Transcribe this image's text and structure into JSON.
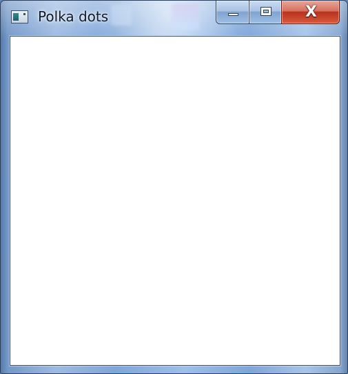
{
  "window": {
    "title": "Polka dots",
    "icon": "application-window-icon"
  },
  "caption_buttons": {
    "minimize": "minimize-icon",
    "maximize": "maximize-icon",
    "close": "close-icon",
    "close_glyph": "X",
    "close_color": "#c8402a"
  },
  "client_area": {
    "background": "#ffffff"
  }
}
